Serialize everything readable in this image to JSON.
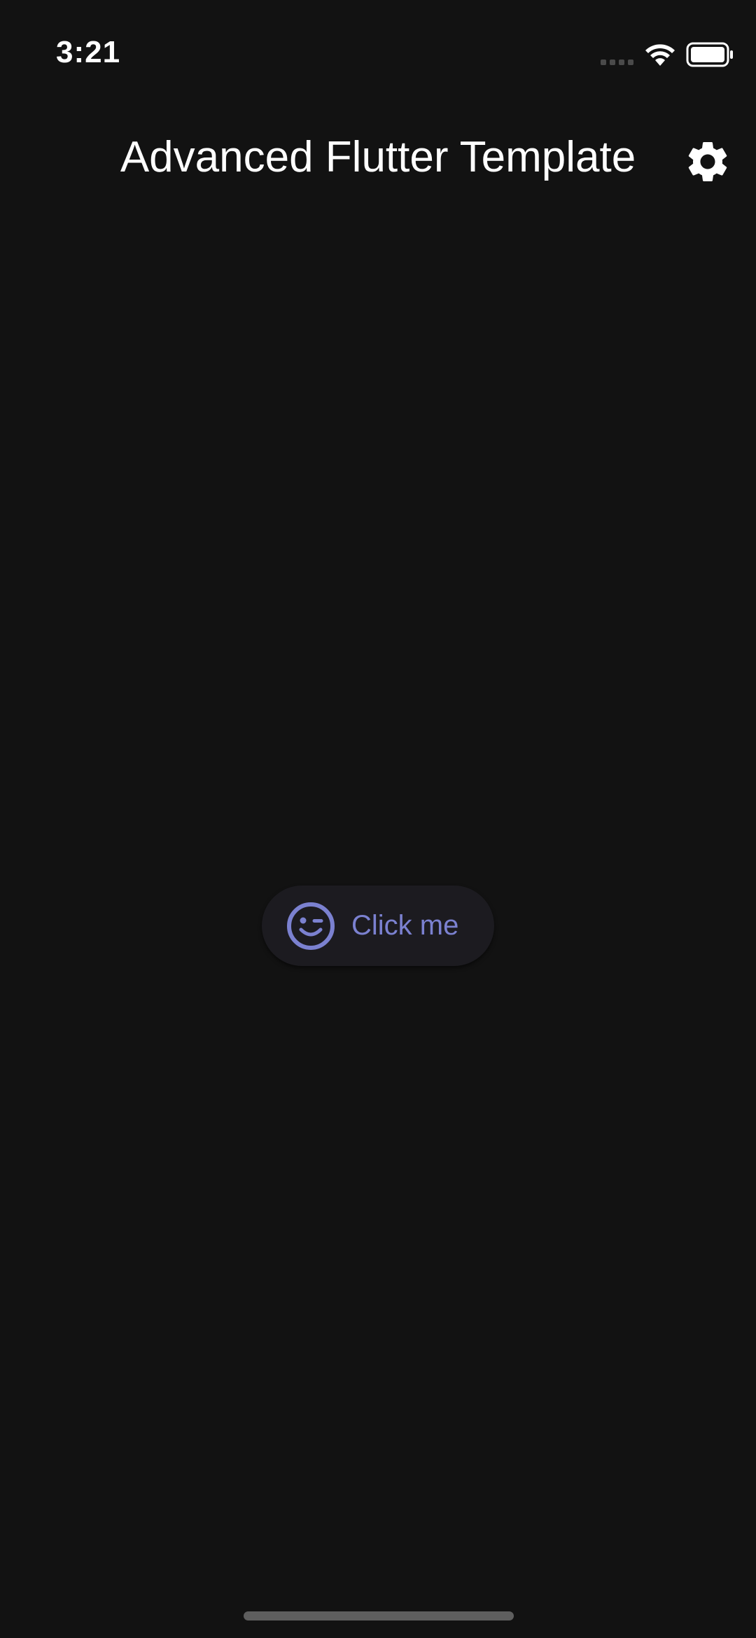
{
  "status_bar": {
    "time": "3:21",
    "icons": [
      "signal-icon",
      "wifi-icon",
      "battery-icon"
    ]
  },
  "app_bar": {
    "title": "Advanced Flutter Template",
    "action_icon": "gear-icon"
  },
  "main": {
    "button": {
      "label": "Click me",
      "icon": "smile-wink-icon"
    }
  },
  "colors": {
    "background": "#121212",
    "title_text": "#ffffff",
    "button_background": "#1c1b20",
    "accent": "#7b81d0",
    "home_indicator": "#5e5e5e"
  }
}
